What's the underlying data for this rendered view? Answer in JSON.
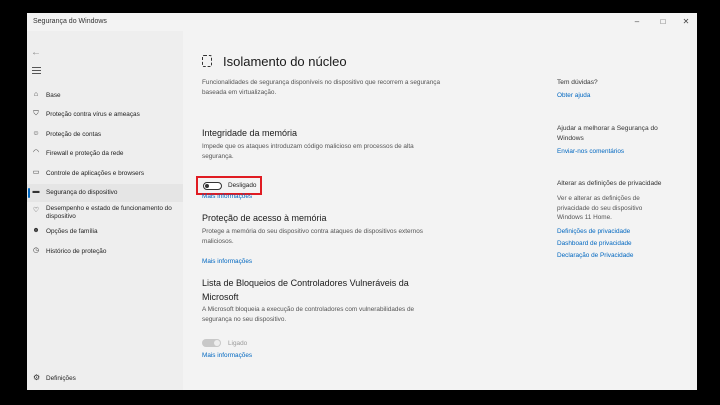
{
  "window": {
    "title": "Segurança do Windows",
    "minimize": "–",
    "maximize": "□",
    "close": "✕"
  },
  "sidebar": {
    "items": [
      {
        "label": "Base",
        "icon": "home-icon"
      },
      {
        "label": "Proteção contra vírus e ameaças",
        "icon": "shield-icon"
      },
      {
        "label": "Proteção de contas",
        "icon": "person-icon"
      },
      {
        "label": "Firewall e proteção da rede",
        "icon": "wifi-icon"
      },
      {
        "label": "Controle de aplicações e browsers",
        "icon": "app-browser-icon"
      },
      {
        "label": "Segurança do dispositivo",
        "icon": "laptop-icon",
        "active": true
      },
      {
        "label": "Desempenho e estado de funcionamento do dispositivo",
        "icon": "heart-icon"
      },
      {
        "label": "Opções de família",
        "icon": "family-icon"
      },
      {
        "label": "Histórico de proteção",
        "icon": "history-icon"
      }
    ],
    "settings_label": "Definições"
  },
  "main": {
    "title": "Isolamento do núcleo",
    "intro": "Funcionalidades de segurança disponíveis no dispositivo que recorrem a segurança baseada em virtualização.",
    "memory_integrity": {
      "heading": "Integridade da memória",
      "desc": "Impede que os ataques introduzam código malicioso em processos de alta segurança.",
      "toggle_label": "Desligado",
      "link": "Mais informações"
    },
    "memory_access": {
      "heading": "Proteção de acesso à memória",
      "desc": "Protege a memória do seu dispositivo contra ataques de dispositivos externos maliciosos.",
      "link": "Mais informações"
    },
    "driver_blocklist": {
      "heading": "Lista de Bloqueios de Controladores Vulneráveis da Microsoft",
      "desc": "A Microsoft bloqueia a execução de controladores com vulnerabilidades de segurança no seu dispositivo.",
      "toggle_label": "Ligado",
      "link": "Mais informações"
    }
  },
  "right": {
    "questions_heading": "Tem dúvidas?",
    "help_link": "Obter ajuda",
    "improve_heading": "Ajudar a melhorar a Segurança do Windows",
    "feedback_link": "Enviar-nos comentários",
    "privacy_heading": "Alterar as definições de privacidade",
    "privacy_text": "Ver e alterar as definições de privacidade do seu dispositivo Windows 11 Home.",
    "privacy_links": [
      "Definições de privacidade",
      "Dashboard de privacidade",
      "Declaração de Privacidade"
    ]
  }
}
